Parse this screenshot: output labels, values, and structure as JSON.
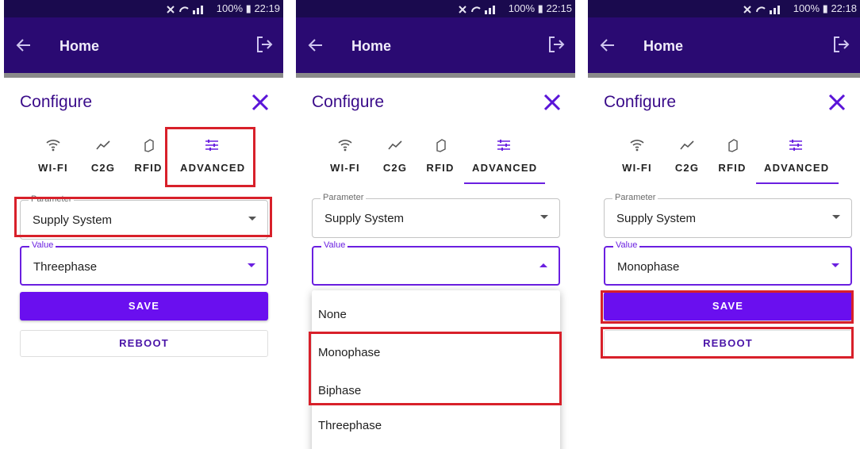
{
  "colors": {
    "status_bar": "#1a0a4e",
    "app_bar": "#2a0a72",
    "accent": "#6a1fe0",
    "save_button": "#6a0fef",
    "highlight": "#d8202a"
  },
  "screens": [
    {
      "status": {
        "battery": "100%",
        "time": "22:19"
      },
      "app_bar": {
        "title": "Home"
      },
      "dialog": {
        "title": "Configure"
      },
      "tabs": [
        {
          "label": "WI-FI",
          "icon": "wifi-icon"
        },
        {
          "label": "C2G",
          "icon": "chart-line-icon"
        },
        {
          "label": "RFID",
          "icon": "nfc-icon"
        },
        {
          "label": "ADVANCED",
          "icon": "tune-icon"
        }
      ],
      "parameter": {
        "label": "Parameter",
        "value": "Supply System"
      },
      "value_field": {
        "label": "Value",
        "value": "Threephase"
      },
      "save_label": "SAVE",
      "reboot_label": "REBOOT"
    },
    {
      "status": {
        "battery": "100%",
        "time": "22:15"
      },
      "app_bar": {
        "title": "Home"
      },
      "dialog": {
        "title": "Configure"
      },
      "tabs": [
        {
          "label": "WI-FI",
          "icon": "wifi-icon"
        },
        {
          "label": "C2G",
          "icon": "chart-line-icon"
        },
        {
          "label": "RFID",
          "icon": "nfc-icon"
        },
        {
          "label": "ADVANCED",
          "icon": "tune-icon"
        }
      ],
      "parameter": {
        "label": "Parameter",
        "value": "Supply System"
      },
      "value_field": {
        "label": "Value",
        "value": ""
      },
      "dropdown_options": [
        "None",
        "Monophase",
        "Biphase",
        "Threephase"
      ]
    },
    {
      "status": {
        "battery": "100%",
        "time": "22:18"
      },
      "app_bar": {
        "title": "Home"
      },
      "dialog": {
        "title": "Configure"
      },
      "tabs": [
        {
          "label": "WI-FI",
          "icon": "wifi-icon"
        },
        {
          "label": "C2G",
          "icon": "chart-line-icon"
        },
        {
          "label": "RFID",
          "icon": "nfc-icon"
        },
        {
          "label": "ADVANCED",
          "icon": "tune-icon"
        }
      ],
      "parameter": {
        "label": "Parameter",
        "value": "Supply System"
      },
      "value_field": {
        "label": "Value",
        "value": "Monophase"
      },
      "save_label": "SAVE",
      "reboot_label": "REBOOT"
    }
  ]
}
